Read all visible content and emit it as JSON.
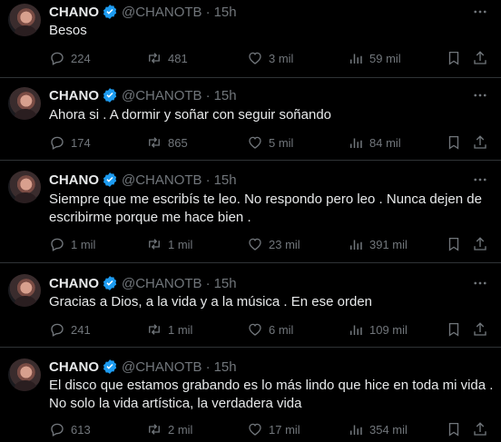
{
  "tweets": [
    {
      "name": "CHANO",
      "handle": "@CHANOTB",
      "separator": "·",
      "time": "15h",
      "lines": [
        "Besos"
      ],
      "replies": "224",
      "retweets": "481",
      "likes": "3 mil",
      "views": "59 mil"
    },
    {
      "name": "CHANO",
      "handle": "@CHANOTB",
      "separator": "·",
      "time": "15h",
      "lines": [
        "Ahora si . A dormir y soñar con seguir soñando"
      ],
      "replies": "174",
      "retweets": "865",
      "likes": "5 mil",
      "views": "84 mil"
    },
    {
      "name": "CHANO",
      "handle": "@CHANOTB",
      "separator": "·",
      "time": "15h",
      "lines": [
        "Siempre que me escribís te leo. No respondo pero leo . Nunca dejen de",
        "escribirme porque me hace bien ."
      ],
      "replies": "1 mil",
      "retweets": "1 mil",
      "likes": "23 mil",
      "views": "391 mil"
    },
    {
      "name": "CHANO",
      "handle": "@CHANOTB",
      "separator": "·",
      "time": "15h",
      "lines": [
        "Gracias a Dios, a la vida y a la música . En ese orden"
      ],
      "replies": "241",
      "retweets": "1 mil",
      "likes": "6 mil",
      "views": "109 mil"
    },
    {
      "name": "CHANO",
      "handle": "@CHANOTB",
      "separator": "·",
      "time": "15h",
      "lines": [
        "El disco que estamos grabando es lo más lindo que hice en toda mi vida .",
        "No solo la vida artística, la verdadera vida"
      ],
      "replies": "613",
      "retweets": "2 mil",
      "likes": "17 mil",
      "views": "354 mil"
    }
  ],
  "icons": {
    "verified": "verified-badge-icon",
    "more": "more-icon",
    "reply": "reply-icon",
    "retweet": "retweet-icon",
    "like": "like-icon",
    "views": "views-icon",
    "bookmark": "bookmark-icon",
    "share": "share-icon"
  },
  "colors": {
    "background": "#000000",
    "text": "#e7e9ea",
    "secondary": "#71767b",
    "divider": "#2f3336",
    "verified": "#1d9bf0"
  }
}
